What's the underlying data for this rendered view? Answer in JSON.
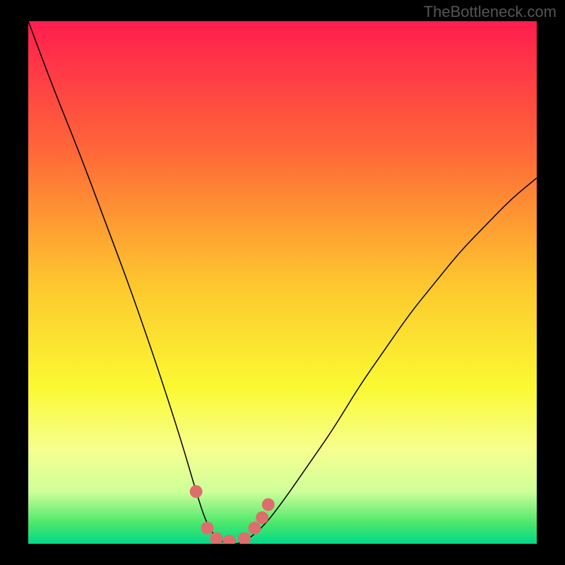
{
  "watermark": "TheBottleneck.com",
  "chart_data": {
    "type": "line",
    "title": "",
    "xlabel": "",
    "ylabel": "",
    "xlim": [
      0,
      100
    ],
    "ylim": [
      0,
      100
    ],
    "series": [
      {
        "name": "curve",
        "x": [
          0,
          5,
          10,
          15,
          20,
          25,
          30,
          33,
          35,
          37,
          39,
          42,
          46,
          50,
          55,
          60,
          65,
          70,
          75,
          80,
          85,
          90,
          95,
          100
        ],
        "y": [
          100,
          87,
          75,
          62,
          49,
          35,
          20,
          10,
          4,
          1,
          0,
          0,
          3,
          8,
          15,
          22,
          30,
          37,
          44,
          50,
          56,
          61,
          66,
          70
        ],
        "stroke": "#000000",
        "stroke_width": 1.5
      }
    ],
    "markers": {
      "x": [
        33.0,
        35.2,
        37.0,
        39.5,
        42.5,
        44.5,
        46.0,
        47.2
      ],
      "y": [
        10.0,
        3.0,
        1.0,
        0.5,
        1.0,
        3.0,
        5.0,
        7.5
      ],
      "color": "#DD6E6B",
      "radius": 9
    },
    "background_gradient": {
      "type": "vertical",
      "stops": [
        {
          "offset": 0.0,
          "color": "#FF1D4E"
        },
        {
          "offset": 0.25,
          "color": "#FF6838"
        },
        {
          "offset": 0.5,
          "color": "#FDC62E"
        },
        {
          "offset": 0.7,
          "color": "#FBF932"
        },
        {
          "offset": 0.82,
          "color": "#F7FF8F"
        },
        {
          "offset": 0.9,
          "color": "#CFFF9A"
        },
        {
          "offset": 0.96,
          "color": "#4CE76B"
        },
        {
          "offset": 1.0,
          "color": "#00D98A"
        }
      ]
    }
  }
}
